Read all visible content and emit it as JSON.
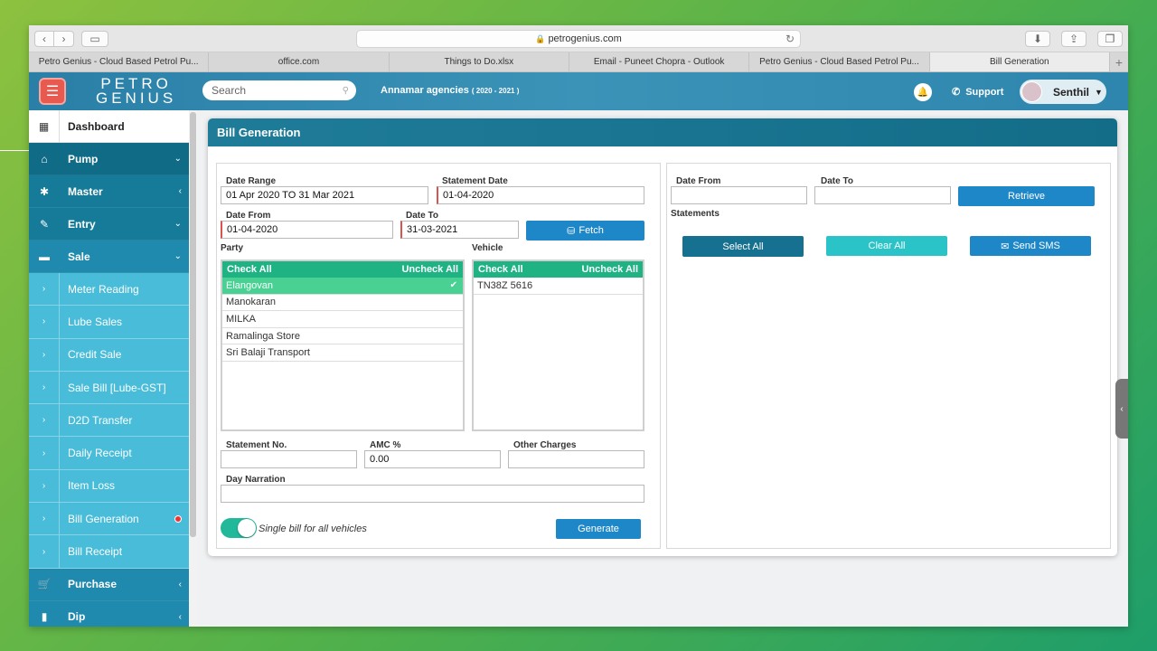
{
  "browser": {
    "url": "petrogenius.com",
    "tabs": [
      "Petro Genius - Cloud Based Petrol Pu...",
      "office.com",
      "Things to Do.xlsx",
      "Email - Puneet Chopra - Outlook",
      "Petro Genius - Cloud Based Petrol Pu...",
      "Bill Generation"
    ]
  },
  "header": {
    "logo_line1": "PETRO",
    "logo_line2": "GENIUS",
    "search_placeholder": "Search",
    "company": "Annamar agencies",
    "company_year": "( 2020 - 2021 )",
    "support": "Support",
    "user_name": "Senthil"
  },
  "sidebar": {
    "dashboard": "Dashboard",
    "sections": [
      {
        "label": "Pump"
      },
      {
        "label": "Master"
      },
      {
        "label": "Entry"
      },
      {
        "label": "Sale"
      }
    ],
    "sale_items": [
      "Meter Reading",
      "Lube Sales",
      "Credit Sale",
      "Sale Bill [Lube-GST]",
      "D2D Transfer",
      "Daily Receipt",
      "Item Loss",
      "Bill Generation",
      "Bill Receipt"
    ],
    "purchase": "Purchase",
    "dip": "Dip"
  },
  "page": {
    "title": "Bill Generation",
    "left": {
      "date_range_label": "Date Range",
      "date_range_value": "01 Apr 2020 TO 31 Mar 2021",
      "statement_date_label": "Statement Date",
      "statement_date_value": "01-04-2020",
      "date_from_label": "Date From",
      "date_from_value": "01-04-2020",
      "date_to_label": "Date To",
      "date_to_value": "31-03-2021",
      "fetch": "Fetch",
      "party_label": "Party",
      "vehicle_label": "Vehicle",
      "check_all": "Check All",
      "uncheck_all": "Uncheck All",
      "parties": [
        "Elangovan",
        "Manokaran",
        "MILKA",
        "Ramalinga Store",
        "Sri Balaji Transport"
      ],
      "vehicles": [
        "TN38Z 5616"
      ],
      "statement_no_label": "Statement No.",
      "statement_no_value": "",
      "amc_label": "AMC %",
      "amc_value": "0.00",
      "other_charges_label": "Other Charges",
      "other_charges_value": "",
      "day_narration_label": "Day Narration",
      "day_narration_value": "",
      "single_bill_label": "Single bill for all vehicles",
      "generate": "Generate"
    },
    "right": {
      "date_from_label": "Date From",
      "date_to_label": "Date To",
      "retrieve": "Retrieve",
      "statements_label": "Statements",
      "select_all": "Select All",
      "clear_all": "Clear All",
      "send_sms": "Send SMS"
    }
  },
  "colors": {
    "header": "#2a7fa7",
    "sidebar": "#3fb6d3",
    "list_header": "#1fb384",
    "selected_row": "#48d192",
    "button_blue": "#1e87c8",
    "menu_button": "#e8594f"
  }
}
